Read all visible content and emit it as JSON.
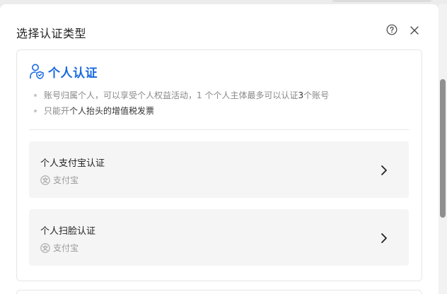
{
  "dialog": {
    "title": "选择认证类型",
    "help_icon": "question-circle-icon",
    "close_icon": "close-icon"
  },
  "panel": {
    "title": "个人认证",
    "icon": "person-shield-icon",
    "accent_color": "#1768e0",
    "bullets": [
      {
        "pre": "账号归属个人，可以享受个人权益活动，1 个个人主体最多可以认证 ",
        "strong": "3",
        "post": " 个账号"
      },
      {
        "pre": "只能开 ",
        "strong": "个人抬头的增值税发票",
        "post": ""
      }
    ]
  },
  "options": [
    {
      "title": "个人支付宝认证",
      "subtitle": "支付宝",
      "icon": "alipay-icon"
    },
    {
      "title": "个人扫脸认证",
      "subtitle": "支付宝",
      "icon": "alipay-icon"
    }
  ]
}
